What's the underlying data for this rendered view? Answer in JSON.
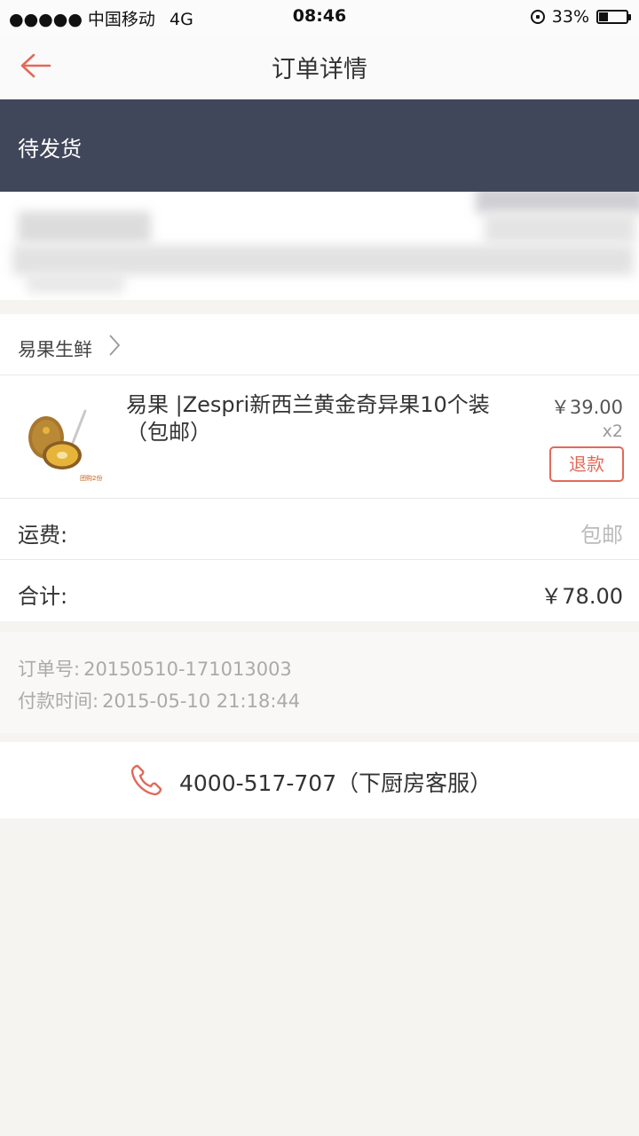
{
  "status_bar": {
    "signal": "●●●●● 中国移动",
    "network": "4G",
    "time": "08:46",
    "battery": "33%",
    "battery_level": 0.33
  },
  "header": {
    "title": "订单详情",
    "back_icon": "arrow-left-icon",
    "accent": "#e06a5a"
  },
  "banner": {
    "status": "待发货",
    "background": "#41475a"
  },
  "shop": {
    "name": "易果生鲜"
  },
  "item": {
    "title": "易果 |Zespri新西兰黄金奇异果10个装（包邮）",
    "price": "￥39.00",
    "quantity": "x2",
    "refund_label": "退款",
    "thumb_caption": "团购2份"
  },
  "fees": {
    "shipping_label": "运费:",
    "shipping_value": "包邮",
    "total_label": "合计:",
    "total_value": "￥78.00"
  },
  "order_info": {
    "order_no_label": "订单号:",
    "order_no": "20150510-171013003",
    "pay_time_label": "付款时间:",
    "pay_time": "2015-05-10 21:18:44"
  },
  "service": {
    "phone": "4000-517-707（下厨房客服）",
    "icon": "phone-icon"
  }
}
